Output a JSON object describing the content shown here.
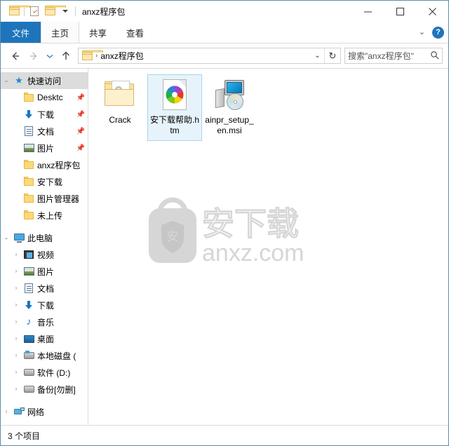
{
  "window": {
    "title": "anxz程序包",
    "quick_access_buttons": [
      "folder-icon",
      "properties-icon",
      "new-folder-icon",
      "customize-dropdown-icon"
    ],
    "controls": {
      "minimize": "minimize-icon",
      "maximize": "maximize-icon",
      "close": "close-icon"
    }
  },
  "ribbon": {
    "tabs": [
      {
        "label": "文件",
        "active": true
      },
      {
        "label": "主页",
        "active": false
      },
      {
        "label": "共享",
        "active": false
      },
      {
        "label": "查看",
        "active": false
      }
    ],
    "collapse_label": "⌄",
    "help_label": "?"
  },
  "address": {
    "back": "back-arrow-icon",
    "forward": "forward-arrow-icon",
    "recent": "recent-locations-icon",
    "up": "up-arrow-icon",
    "crumb_icon": "folder-icon",
    "crumb_separator": "›",
    "path": "anxz程序包",
    "dropdown": "⌄",
    "refresh": "↻"
  },
  "search": {
    "placeholder": "搜索\"anxz程序包\"",
    "icon": "search-icon"
  },
  "navigation": {
    "quick_access": {
      "label": "快速访问",
      "icon": "star-pin-icon",
      "expander": "⌄",
      "selected": true,
      "children": [
        {
          "label": "Desktc",
          "icon": "folder-icon",
          "pinned": true
        },
        {
          "label": "下载",
          "icon": "downloads-icon",
          "pinned": true
        },
        {
          "label": "文档",
          "icon": "documents-icon",
          "pinned": true
        },
        {
          "label": "图片",
          "icon": "pictures-icon",
          "pinned": true
        },
        {
          "label": "anxz程序包",
          "icon": "folder-icon",
          "pinned": false
        },
        {
          "label": "安下载",
          "icon": "folder-icon",
          "pinned": false
        },
        {
          "label": "图片管理器",
          "icon": "folder-icon",
          "pinned": false
        },
        {
          "label": "未上传",
          "icon": "folder-icon",
          "pinned": false
        }
      ]
    },
    "this_pc": {
      "label": "此电脑",
      "icon": "this-pc-icon",
      "expander": "⌄",
      "children": [
        {
          "label": "视频",
          "icon": "videos-icon",
          "expander": "›"
        },
        {
          "label": "图片",
          "icon": "pictures-icon",
          "expander": "›"
        },
        {
          "label": "文档",
          "icon": "documents-icon",
          "expander": "›"
        },
        {
          "label": "下载",
          "icon": "downloads-icon",
          "expander": "›"
        },
        {
          "label": "音乐",
          "icon": "music-icon",
          "expander": "›"
        },
        {
          "label": "桌面",
          "icon": "desktop-icon",
          "expander": "›"
        },
        {
          "label": "本地磁盘 (",
          "icon": "system-drive-icon",
          "expander": "›"
        },
        {
          "label": "软件 (D:)",
          "icon": "drive-icon",
          "expander": "›"
        },
        {
          "label": "备份[勿删]",
          "icon": "drive-icon",
          "expander": "›"
        }
      ]
    },
    "network": {
      "label": "网络",
      "icon": "network-icon",
      "expander": "›"
    }
  },
  "files": [
    {
      "name": "Crack",
      "icon": "folder-with-gears-icon",
      "selected": false
    },
    {
      "name": "安下载帮助.htm",
      "icon": "html-document-icon",
      "selected": true
    },
    {
      "name": "ainpr_setup_en.msi",
      "icon": "msi-installer-icon",
      "selected": false
    }
  ],
  "watermark": {
    "brand_cn": "安下载",
    "brand_url": "anxz.com",
    "shield_char": "安",
    "color": "#d6d6d6"
  },
  "status": {
    "item_count": "3 个项目"
  },
  "colors": {
    "accent": "#1e75bb",
    "selection_bg": "#e7f3fb",
    "selection_border": "#a8d3ef",
    "nav_selected_bg": "#dcdcdc",
    "window_border": "#5a8fa8"
  }
}
